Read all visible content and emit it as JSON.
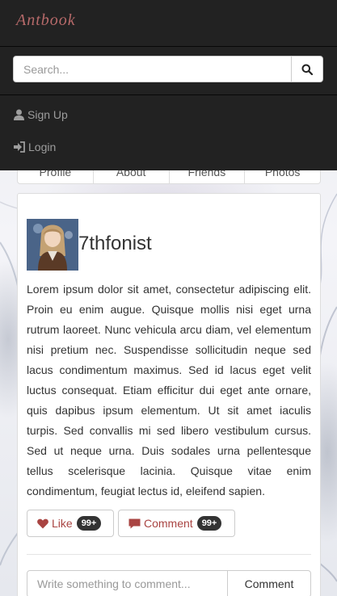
{
  "navbar": {
    "brand": "Antbook",
    "search": {
      "placeholder": "Search...",
      "value": ""
    },
    "menu": [
      {
        "label": "Sign Up",
        "icon": "user-icon"
      },
      {
        "label": "Login",
        "icon": "login-icon"
      }
    ]
  },
  "tabs": [
    "Profile",
    "About",
    "Friends",
    "Photos"
  ],
  "post": {
    "username": "7thfonist",
    "text": "Lorem ipsum dolor sit amet, consectetur adipiscing elit. Proin eu enim augue. Quisque mollis nisi eget urna rutrum laoreet. Nunc vehicula arcu diam, vel elementum nisi pretium nec. Suspendisse sollicitudin neque sed lacus condimentum maximus. Sed id lacus eget velit luctus consequat. Etiam efficitur dui eget ante ornare, quis dapibus ipsum elementum. Ut sit amet iaculis turpis. Sed convallis mi sed libero vestibulum cursus. Sed ut neque urna. Duis sodales urna pellentesque tellus scelerisque lacinia. Quisque vitae enim condimentum, feugiat lectus id, eleifend sapien.",
    "like": {
      "label": "Like",
      "count": "99+",
      "icon": "heart-icon"
    },
    "comment": {
      "label": "Comment",
      "count": "99+",
      "icon": "comment-icon"
    },
    "comment_box": {
      "placeholder": "Write something to comment...",
      "button": "Comment"
    }
  },
  "colors": {
    "navbar": "#222222",
    "accent": "#a94442",
    "brand": "#b76a6a"
  }
}
